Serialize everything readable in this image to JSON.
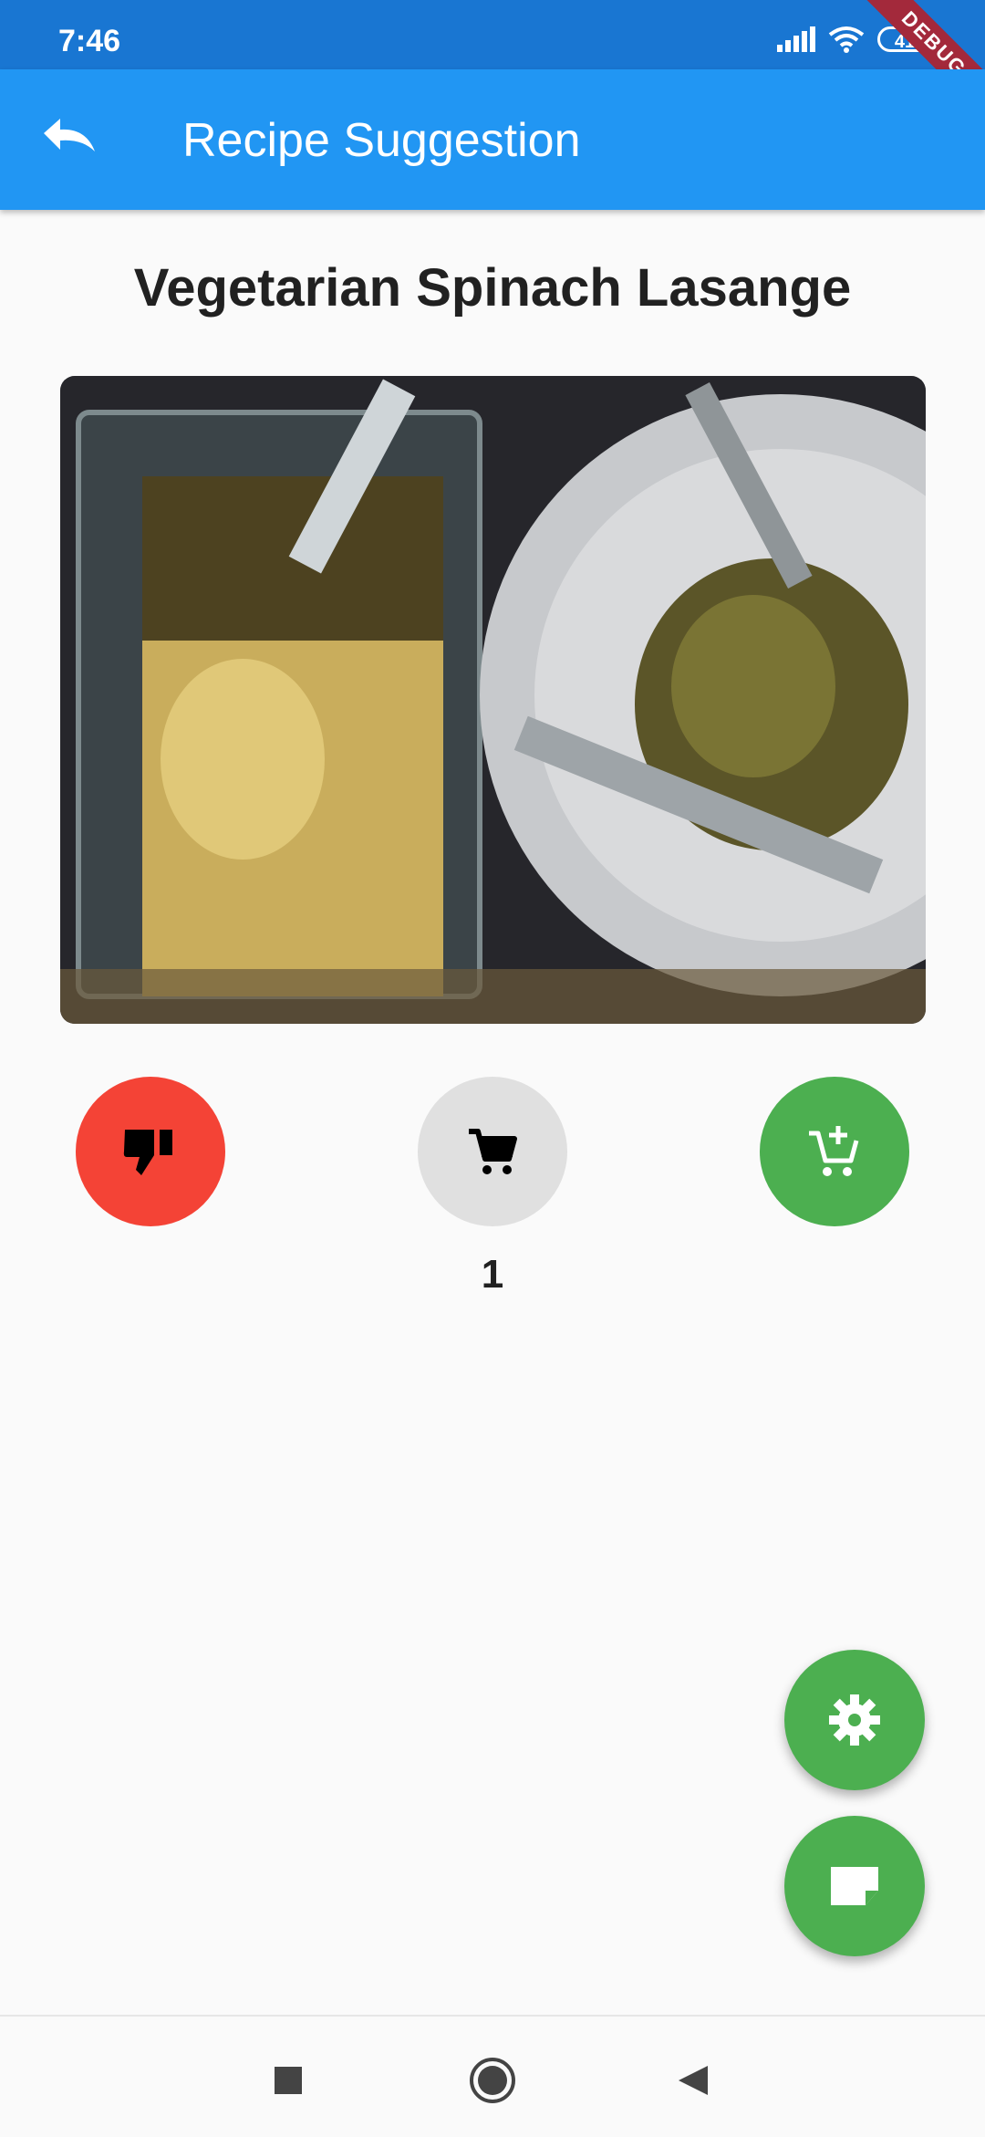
{
  "status_bar": {
    "time": "7:46",
    "battery": "41"
  },
  "debug_banner": "DEBUG",
  "app_bar": {
    "title": "Recipe Suggestion",
    "back_icon": "undo-arrow-icon"
  },
  "recipe": {
    "title": "Vegetarian Spinach Lasange",
    "image": "lasagna-photo"
  },
  "actions": {
    "dislike_icon": "thumb-down-icon",
    "cart_icon": "shopping-cart-icon",
    "add_cart_icon": "add-shopping-cart-icon",
    "cart_count": "1"
  },
  "fabs": {
    "settings_icon": "gear-icon",
    "note_icon": "note-icon"
  },
  "colors": {
    "status_bar": "#1976d2",
    "app_bar": "#2196f3",
    "dislike": "#f44336",
    "cart": "#e0e0e0",
    "add_cart": "#4caf50",
    "fab": "#4caf50"
  }
}
